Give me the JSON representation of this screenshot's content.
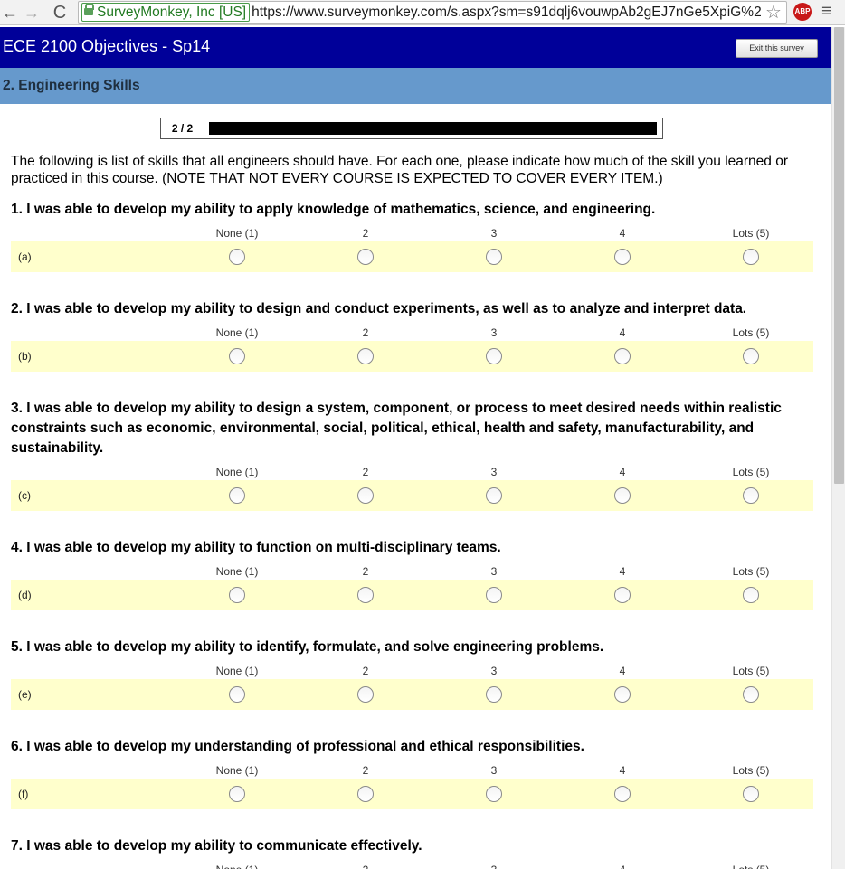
{
  "browser": {
    "back_icon": "←",
    "forward_icon": "→",
    "reload_icon": "C",
    "ev_label": "SurveyMonkey, Inc [US]",
    "url": "https://www.surveymonkey.com/s.aspx?sm=s91dqlj6vouwpAb2gEJ7nGe5XpiG%2",
    "star_icon": "☆",
    "abp_label": "ABP",
    "menu_icon": "≡"
  },
  "survey": {
    "title": "ECE 2100 Objectives - Sp14",
    "exit_label": "Exit this survey",
    "page_heading": "2. Engineering Skills",
    "progress_label": "2 / 2",
    "progress_fraction": 1.0,
    "intro": "The following is list of skills that all engineers should have. For each one, please indicate how much of the skill you learned or practiced in this course. (NOTE THAT NOT EVERY COURSE IS EXPECTED TO COVER EVERY ITEM.)"
  },
  "scale": [
    "None (1)",
    "2",
    "3",
    "4",
    "Lots (5)"
  ],
  "questions": [
    {
      "title": "1. I was able to develop my ability to apply knowledge of mathematics, science, and engineering.",
      "row_label": "(a)"
    },
    {
      "title": "2. I was able to develop my ability to design and conduct experiments, as well as to analyze and interpret data.",
      "row_label": "(b)"
    },
    {
      "title": "3. I was able to develop my ability to design a system, component, or process to meet desired needs within realistic constraints such as economic, environmental, social, political, ethical, health and safety, manufacturability, and sustainability.",
      "row_label": "(c)"
    },
    {
      "title": "4. I was able to develop my ability to function on multi-disciplinary teams.",
      "row_label": "(d)"
    },
    {
      "title": "5. I was able to develop my ability to identify, formulate, and solve engineering problems.",
      "row_label": "(e)"
    },
    {
      "title": "6. I was able to develop my understanding of professional and ethical responsibilities.",
      "row_label": "(f)"
    },
    {
      "title": "7. I was able to develop my ability to communicate effectively.",
      "row_label": ""
    }
  ]
}
